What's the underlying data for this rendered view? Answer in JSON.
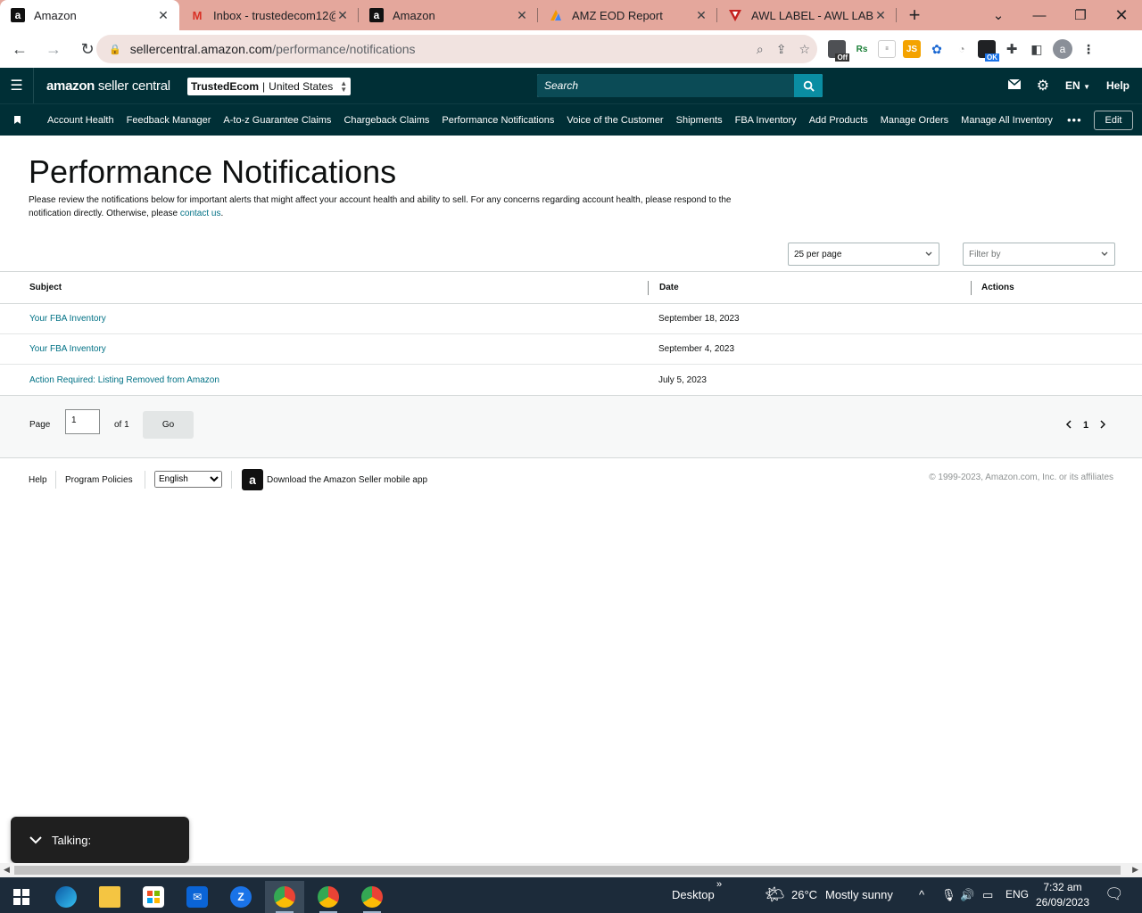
{
  "browser": {
    "tabs": [
      {
        "title": "Amazon",
        "favicon": "amazon-icon",
        "active": true
      },
      {
        "title": "Inbox - trustedecom12@",
        "favicon": "gmail-icon",
        "active": false
      },
      {
        "title": "Amazon",
        "favicon": "amazon-icon",
        "active": false
      },
      {
        "title": "AMZ EOD Report",
        "favicon": "report-icon",
        "active": false
      },
      {
        "title": "AWL LABEL - AWL LABEL",
        "favicon": "awl-icon",
        "active": false
      }
    ],
    "url_host": "sellercentral.amazon.com",
    "url_path": "/performance/notifications",
    "ext_badge_off": "Off",
    "ext_badge_ok": "OK",
    "profile_initial": "a"
  },
  "header": {
    "logo_bold": "amazon",
    "logo_rest": " seller central",
    "account_name": "TrustedEcom",
    "account_region": "United States",
    "search_placeholder": "Search",
    "language": "EN",
    "help": "Help"
  },
  "nav": {
    "items": [
      "Account Health",
      "Feedback Manager",
      "A-to-z Guarantee Claims",
      "Chargeback Claims",
      "Performance Notifications",
      "Voice of the Customer",
      "Shipments",
      "FBA Inventory",
      "Add Products",
      "Manage Orders",
      "Manage All Inventory"
    ],
    "more": "•••",
    "edit": "Edit"
  },
  "page": {
    "title": "Performance Notifications",
    "intro": "Please review the notifications below for important alerts that might affect your account health and ability to sell. For any concerns regarding account health, please respond to the notification directly. Otherwise, please ",
    "contact_link": "contact us",
    "intro_end": ".",
    "per_page": "25 per page",
    "filter_placeholder": "Filter by"
  },
  "table": {
    "headers": {
      "subject": "Subject",
      "date": "Date",
      "actions": "Actions"
    },
    "rows": [
      {
        "subject": "Your FBA Inventory",
        "date": "September 18, 2023"
      },
      {
        "subject": "Your FBA Inventory",
        "date": "September 4, 2023"
      },
      {
        "subject": "Action Required: Listing Removed from Amazon",
        "date": "July 5, 2023"
      }
    ]
  },
  "pager": {
    "page_label": "Page",
    "page_value": "1",
    "of_label": "of 1",
    "go": "Go",
    "current": "1"
  },
  "footer": {
    "help": "Help",
    "policies": "Program Policies",
    "language": "English",
    "app_text": "Download the Amazon Seller mobile app",
    "copyright": "© 1999-2023, Amazon.com, Inc. or its affiliates"
  },
  "overlay": {
    "talking": "Talking:"
  },
  "taskbar": {
    "desktop": "Desktop",
    "weather_temp": "26°C",
    "weather_desc": "Mostly sunny",
    "lang": "ENG",
    "time": "7:32 am",
    "date": "26/09/2023"
  }
}
